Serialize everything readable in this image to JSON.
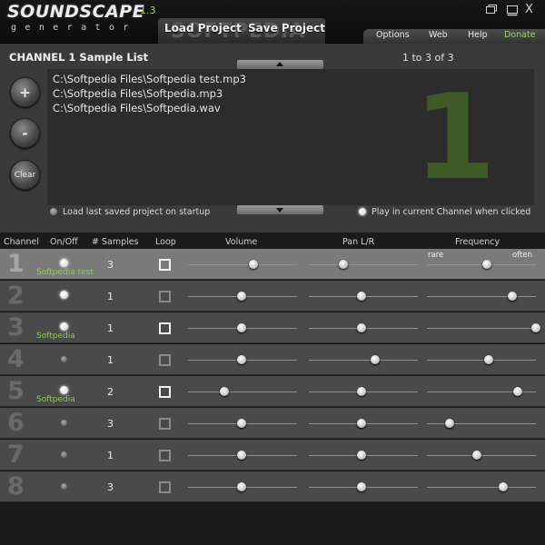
{
  "app": {
    "title": "SOUNDSCAPE",
    "version": "1.3",
    "subtitle": "generator",
    "watermark": "SOFTPEDIA",
    "load_label": "Load Project",
    "save_label": "Save Project",
    "close_label": "X"
  },
  "menu": {
    "options": "Options",
    "web": "Web",
    "help": "Help",
    "donate": "Donate"
  },
  "colors": {
    "accent": "#8fd23e",
    "donate": "#a3d45c",
    "big_number": "#3f5a26"
  },
  "sample_panel": {
    "title": "CHANNEL 1 Sample List",
    "count": "1 to 3 of 3",
    "add_label": "+",
    "remove_label": "-",
    "clear_label": "Clear",
    "big_number": "1",
    "files": [
      "C:\\Softpedia Files\\Softpedia test.mp3",
      "C:\\Softpedia Files\\Softpedia.mp3",
      "C:\\Softpedia Files\\Softpedia.wav"
    ],
    "option_load_last": "Load last saved project on startup",
    "option_play_click": "Play in current Channel when clicked"
  },
  "table": {
    "headers": {
      "channel": "Channel",
      "onoff": "On/Off",
      "samples": "# Samples",
      "loop": "Loop",
      "volume": "Volume",
      "pan": "Pan L/R",
      "frequency": "Frequency"
    },
    "freq_rare": "rare",
    "freq_often": "often",
    "rows": [
      {
        "num": "1",
        "on": true,
        "name": "Softpedia test",
        "samples": "3",
        "loop": true,
        "volume": 0.6,
        "pan": 0.32,
        "freq": 0.55
      },
      {
        "num": "2",
        "on": true,
        "name": "",
        "samples": "1",
        "loop": false,
        "volume": 0.49,
        "pan": 0.48,
        "freq": 0.78
      },
      {
        "num": "3",
        "on": true,
        "name": "Softpedia",
        "samples": "1",
        "loop": true,
        "volume": 0.49,
        "pan": 0.48,
        "freq": 1.0
      },
      {
        "num": "4",
        "on": false,
        "name": "",
        "samples": "1",
        "loop": false,
        "volume": 0.49,
        "pan": 0.61,
        "freq": 0.57
      },
      {
        "num": "5",
        "on": true,
        "name": "Softpedia",
        "samples": "2",
        "loop": true,
        "volume": 0.33,
        "pan": 0.48,
        "freq": 0.83
      },
      {
        "num": "6",
        "on": false,
        "name": "",
        "samples": "3",
        "loop": false,
        "volume": 0.49,
        "pan": 0.48,
        "freq": 0.21
      },
      {
        "num": "7",
        "on": false,
        "name": "",
        "samples": "1",
        "loop": false,
        "volume": 0.49,
        "pan": 0.48,
        "freq": 0.46
      },
      {
        "num": "8",
        "on": false,
        "name": "",
        "samples": "3",
        "loop": false,
        "volume": 0.49,
        "pan": 0.48,
        "freq": 0.7
      }
    ]
  }
}
